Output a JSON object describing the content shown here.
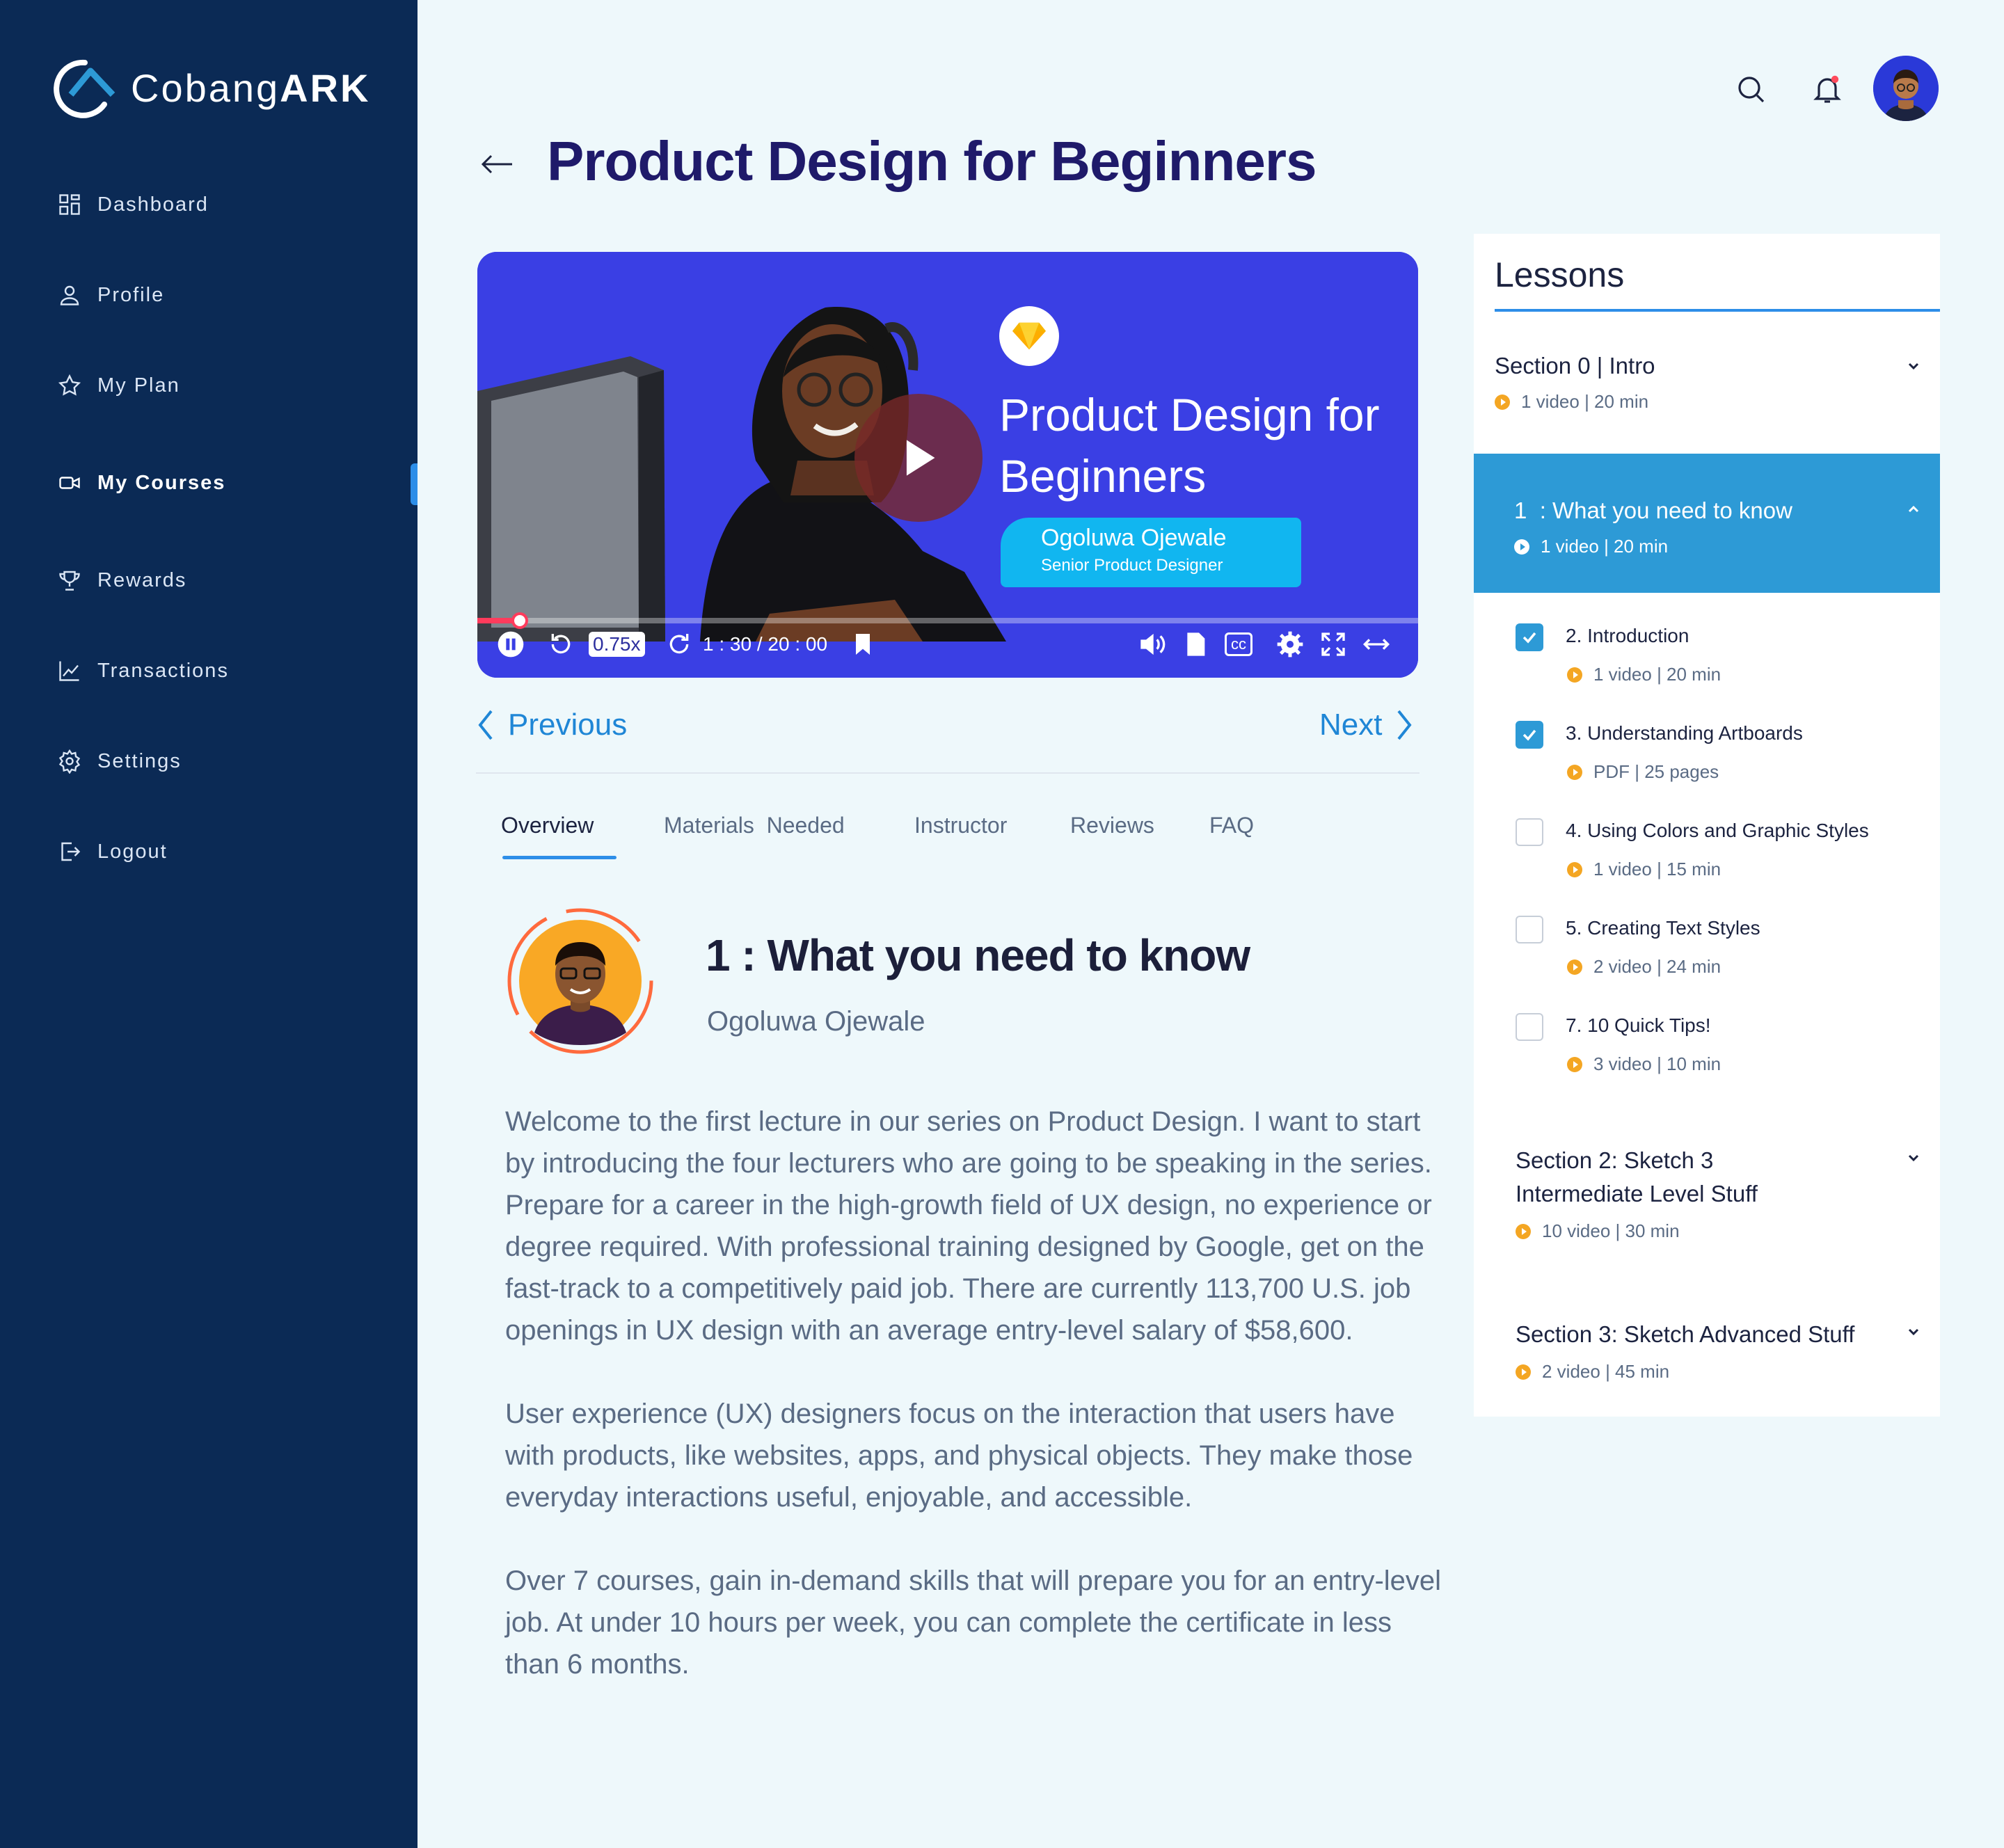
{
  "brand": {
    "name_light": "Cobang",
    "name_bold": "ARK"
  },
  "sidebar": {
    "items": [
      {
        "label": "Dashboard",
        "icon": "dashboard-icon"
      },
      {
        "label": "Profile",
        "icon": "user-icon"
      },
      {
        "label": "My Plan",
        "icon": "star-icon"
      },
      {
        "label": "My Courses",
        "icon": "video-camera-icon",
        "active": true
      },
      {
        "label": "Rewards",
        "icon": "trophy-icon"
      },
      {
        "label": "Transactions",
        "icon": "chart-icon"
      },
      {
        "label": "Settings",
        "icon": "gear-icon"
      },
      {
        "label": "Logout",
        "icon": "logout-icon"
      }
    ]
  },
  "header": {
    "search_icon": "search-icon",
    "bell_icon": "bell-icon",
    "notification_dot_color": "#ff4b5c"
  },
  "page": {
    "title": "Product Design for Beginners"
  },
  "video": {
    "title": "Product Design for Beginners",
    "presenter_name": "Ogoluwa Ojewale",
    "presenter_role": "Senior Product Designer",
    "speed": "0.75x",
    "time": "1 : 30 / 20 : 00",
    "progress": 0.045,
    "cc_label": "cc"
  },
  "navigation": {
    "previous_label": "Previous",
    "next_label": "Next"
  },
  "tabs": [
    {
      "label": "Overview",
      "active": true
    },
    {
      "label": "Materials  Needed"
    },
    {
      "label": "Instructor"
    },
    {
      "label": "Reviews"
    },
    {
      "label": "FAQ"
    }
  ],
  "lesson": {
    "heading": "1 : What you need to know",
    "instructor": "Ogoluwa Ojewale",
    "paragraphs": [
      "Welcome to the first lecture in our series on Product Design. I want to start by introducing the four lecturers who are going to be speaking in the series.",
      "Prepare for a career in the high-growth field of UX design, no experience or degree required. With professional training designed by Google, get on the fast-track to a competitively paid job. There are currently 113,700 U.S. job openings in UX design with an average entry-level salary of $58,600.",
      "User experience (UX) designers focus on the interaction that users have with products, like websites, apps, and physical objects. They make those everyday interactions useful, enjoyable, and accessible.",
      "Over 7 courses, gain in-demand skills that will prepare you for an entry-level job. At under 10 hours per week, you can complete the certificate in less than 6 months."
    ]
  },
  "lessons": {
    "title": "Lessons",
    "section0": {
      "title": "Section 0 | Intro",
      "meta": "1 video | 20 min"
    },
    "active_section": {
      "title": "1  : What you need to know",
      "meta": "1 video | 20 min"
    },
    "items": [
      {
        "title": "2. Introduction",
        "meta": "1 video | 20 min",
        "checked": true
      },
      {
        "title": "3. Understanding Artboards",
        "meta": "PDF | 25 pages",
        "checked": true
      },
      {
        "title": "4. Using Colors and Graphic Styles",
        "meta": "1 video | 15 min",
        "checked": false
      },
      {
        "title": "5. Creating Text Styles",
        "meta": "2 video | 24 min",
        "checked": false
      },
      {
        "title": "7. 10 Quick Tips!",
        "meta": "3 video | 10 min",
        "checked": false
      }
    ],
    "section2": {
      "title_line1": "Section 2: Sketch 3",
      "title_line2": "Intermediate Level Stuff",
      "meta": "10 video | 30 min"
    },
    "section3": {
      "title": "Section 3: Sketch Advanced Stuff",
      "meta": "2 video | 45 min"
    }
  },
  "colors": {
    "sidebar": "#0b2a55",
    "accent": "#2d8ee8",
    "title": "#1f1a6a",
    "video_bg": "#3a3fe4",
    "bullet": "#f4a623"
  }
}
